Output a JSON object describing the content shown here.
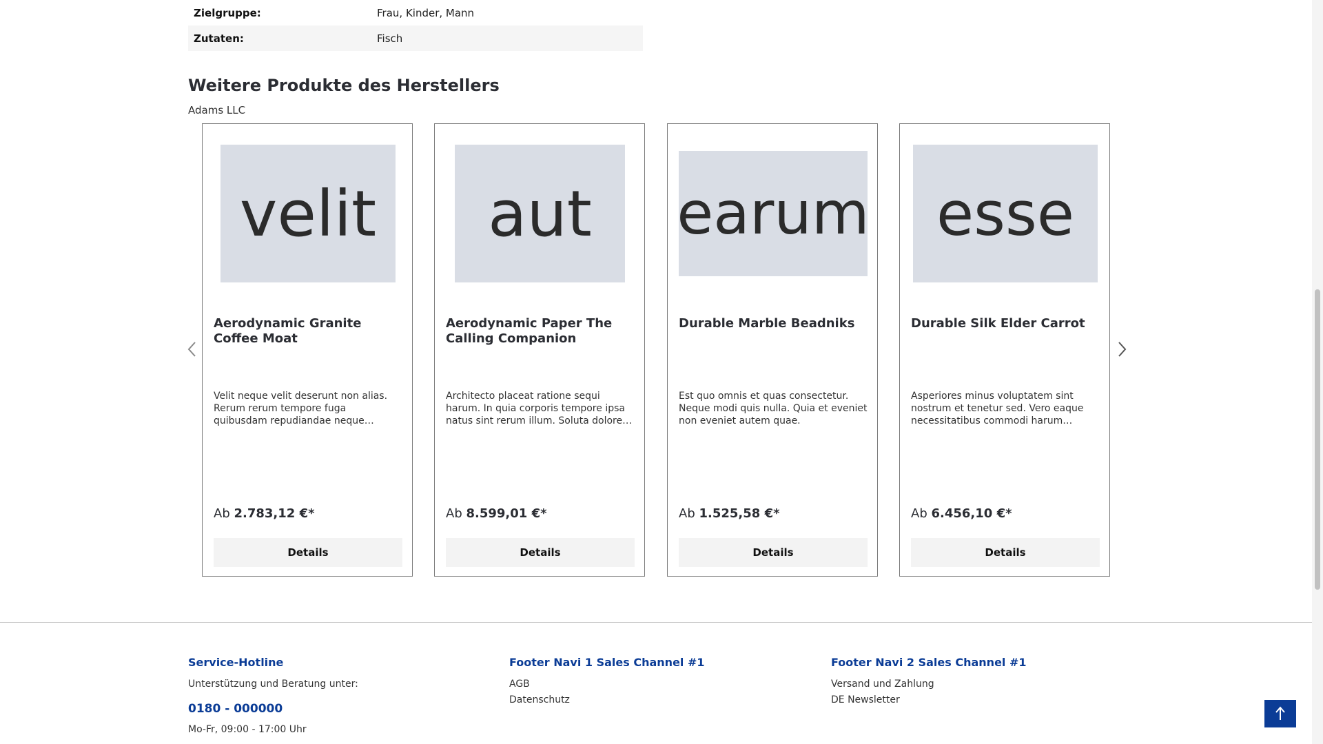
{
  "properties": [
    {
      "key": "Zielgruppe:",
      "value": "Frau, Kinder, Mann"
    },
    {
      "key": "Zutaten:",
      "value": "Fisch"
    }
  ],
  "manufacturer_section": {
    "title": "Weitere Produkte des Herstellers",
    "manufacturer": "Adams LLC"
  },
  "products": [
    {
      "image_text": "velit",
      "name": "Aerodynamic Granite Coffee Moat",
      "description": "Velit neque velit deserunt non alias. Rerum rerum tempore fuga quibusdam repudiandae neque delectus. Perspiciatis voluptatem officiis dolorem.",
      "price_prefix": "Ab",
      "price": "2.783,12 €*",
      "button": "Details"
    },
    {
      "image_text": "aut",
      "name": "Aerodynamic Paper The Calling Companion",
      "description": "Architecto placeat ratione sequi harum. In quia corporis tempore ipsa natus sint rerum illum. Soluta dolore commodi quia eum.",
      "price_prefix": "Ab",
      "price": "8.599,01 €*",
      "button": "Details"
    },
    {
      "image_text": "earum",
      "name": "Durable Marble Beadniks",
      "description": "Est quo omnis et quas consectetur. Neque modi quis nulla. Quia et eveniet non eveniet autem quae.",
      "price_prefix": "Ab",
      "price": "1.525,58 €*",
      "button": "Details"
    },
    {
      "image_text": "esse",
      "name": "Durable Silk Elder Carrot",
      "description": "Asperiores minus voluptatem sint nostrum et tenetur sed. Vero eaque necessitatibus commodi harum suscipit natus quia.",
      "price_prefix": "Ab",
      "price": "6.456,10 €*",
      "button": "Details"
    }
  ],
  "footer": {
    "service": {
      "title": "Service-Hotline",
      "text": "Unterstützung und Beratung unter:",
      "phone": "0180 - 000000",
      "hours": "Mo-Fr, 09:00 - 17:00 Uhr"
    },
    "nav1": {
      "title": "Footer Navi 1 Sales Channel #1",
      "links": [
        "AGB",
        "Datenschutz"
      ]
    },
    "nav2": {
      "title": "Footer Navi 2 Sales Channel #1",
      "links": [
        "Versand und Zahlung",
        "DE Newsletter"
      ]
    }
  },
  "colors": {
    "accent": "#0b3c96",
    "image_placeholder": "#d9dde5"
  },
  "icons": {
    "prev": "chevron-left-icon",
    "next": "chevron-right-icon",
    "scroll_top": "arrow-up-icon"
  }
}
